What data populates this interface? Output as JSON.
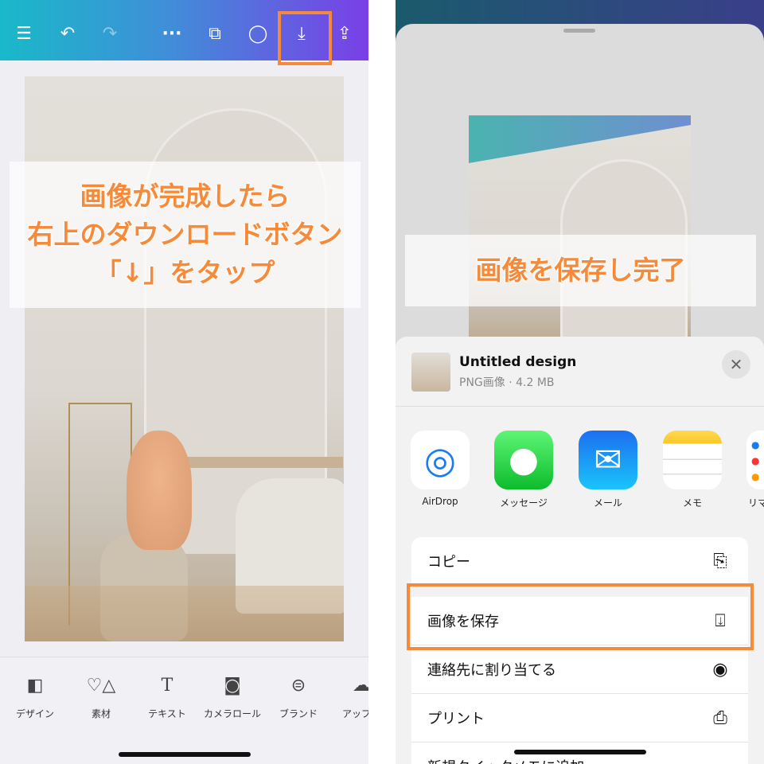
{
  "left": {
    "toolbar": {
      "icons": [
        "menu-icon",
        "undo-icon",
        "redo-icon",
        "more-icon",
        "duplicate-icon",
        "comment-icon",
        "download-icon",
        "share-icon"
      ]
    },
    "overlay_lines": [
      "画像が完成したら",
      "右上のダウンロードボタン",
      "「↓」をタップ"
    ],
    "bottom_tools": [
      {
        "label": "デザイン",
        "icon": "design-icon"
      },
      {
        "label": "素材",
        "icon": "elements-icon"
      },
      {
        "label": "テキスト",
        "icon": "text-icon"
      },
      {
        "label": "カメラロール",
        "icon": "camera-icon"
      },
      {
        "label": "ブランド",
        "icon": "brand-icon"
      },
      {
        "label": "アップロ",
        "icon": "upload-icon"
      }
    ],
    "highlight_color": "#f58b3a"
  },
  "right": {
    "overlay_text": "画像を保存し完了",
    "share": {
      "title": "Untitled design",
      "subtitle": "PNG画像 · 4.2 MB",
      "apps": [
        {
          "label": "AirDrop"
        },
        {
          "label": "メッセージ"
        },
        {
          "label": "メール"
        },
        {
          "label": "メモ"
        },
        {
          "label": "リマ"
        }
      ],
      "actions": [
        {
          "label": "コピー",
          "icon": "copy-icon"
        },
        {
          "label": "画像を保存",
          "icon": "save-image-icon"
        },
        {
          "label": "連絡先に割り当てる",
          "icon": "contact-icon"
        },
        {
          "label": "プリント",
          "icon": "print-icon"
        },
        {
          "label": "新規クイックメモに追加",
          "icon": "quick-note-icon"
        }
      ]
    }
  }
}
